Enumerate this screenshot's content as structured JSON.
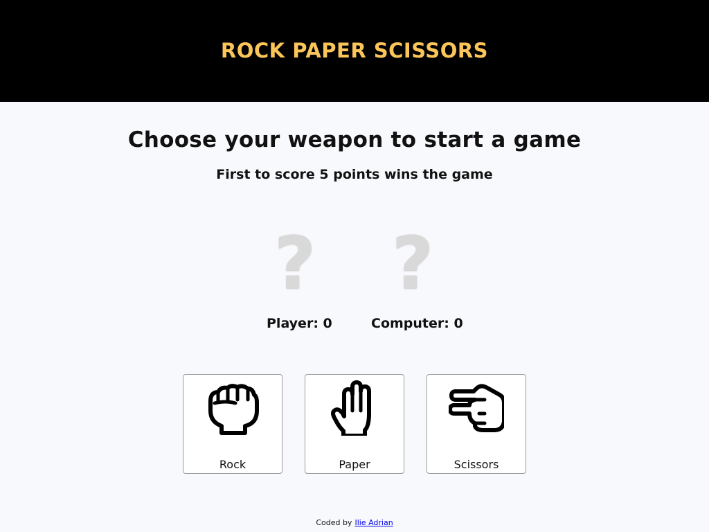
{
  "header": {
    "title": "ROCK PAPER SCISSORS"
  },
  "main": {
    "headline": "Choose your weapon to start a game",
    "subline": "First to score 5 points wins the game"
  },
  "scoreboard": {
    "player_choice_icon": "question-mark-icon",
    "computer_choice_icon": "question-mark-icon",
    "player_mark": "?",
    "computer_mark": "?",
    "player_score_text": "Player: 0",
    "computer_score_text": "Computer: 0"
  },
  "weapons": [
    {
      "label": "Rock",
      "icon": "fist-icon"
    },
    {
      "label": "Paper",
      "icon": "open-hand-icon"
    },
    {
      "label": "Scissors",
      "icon": "scissors-hand-icon"
    }
  ],
  "footer": {
    "prefix": "Coded by",
    "link_text": "Ilie Adrian"
  },
  "colors": {
    "header_bg": "#000000",
    "title": "#fbc55a",
    "link": "#0000ee",
    "question_mark": "#d9d9d9"
  }
}
